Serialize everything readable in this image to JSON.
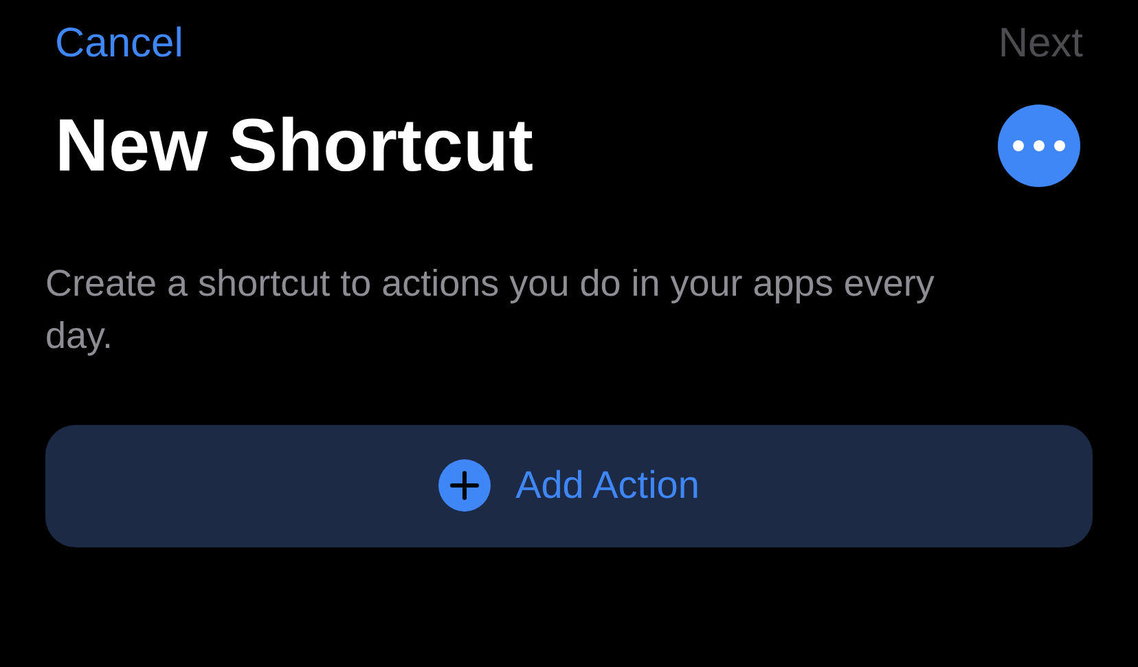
{
  "nav": {
    "cancel": "Cancel",
    "next": {
      "label": "Next",
      "disabled": true
    }
  },
  "title": "New Shortcut",
  "description": "Create a shortcut to actions you do in your apps every day.",
  "add_button": "Add Action"
}
